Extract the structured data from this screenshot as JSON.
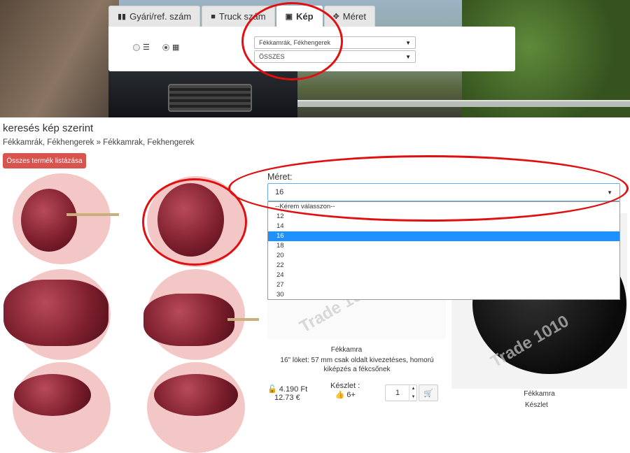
{
  "tabs": [
    {
      "label": "Gyári/ref. szám",
      "icon": "barcode-icon",
      "active": false
    },
    {
      "label": "Truck szám",
      "icon": "truck-icon",
      "active": false
    },
    {
      "label": "Kép",
      "icon": "image-icon",
      "active": true
    },
    {
      "label": "Méret",
      "icon": "move-icon",
      "active": false
    }
  ],
  "filter": {
    "category_select": "Fékkamrák, Fékhengerek",
    "sub_select": "ÖSSZES"
  },
  "page": {
    "title": "keresés kép szerint",
    "breadcrumb": "Fékkamrák, Fékhengerek » Fékkamrak, Fekhengerek",
    "list_all_button": "Összes termék listázása"
  },
  "size_filter": {
    "label": "Méret:",
    "selected": "16",
    "options": [
      "--Kérem válasszon--",
      "12",
      "14",
      "16",
      "18",
      "20",
      "22",
      "24",
      "27",
      "30"
    ],
    "highlighted_index": 3
  },
  "product1": {
    "title": "Fékkamra",
    "description": "16\" löket: 57 mm csak oldalt kivezetéses, homorú kiképzés a fékcsőnek",
    "price_huf": "4.190 Ft",
    "price_eur": "12.73 €",
    "stock_label": "Készlet :",
    "stock_value": "6+",
    "quantity": "1",
    "watermark": "Trade 1010"
  },
  "product2": {
    "title": "Fékkamra",
    "stock_label": "Készlet",
    "watermark": "Trade 1010"
  },
  "colors": {
    "annotation_red": "#e01010",
    "button_red": "#d9534f",
    "highlight_blue": "#1e90ff",
    "thumb_pink": "#f4c7c7"
  }
}
